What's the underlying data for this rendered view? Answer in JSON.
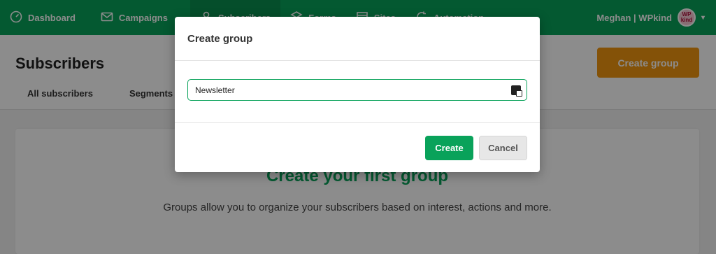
{
  "nav": {
    "items": [
      {
        "label": "Dashboard",
        "icon": "dashboard-icon"
      },
      {
        "label": "Campaigns",
        "icon": "mail-icon"
      },
      {
        "label": "Subscribers",
        "icon": "user-icon",
        "active": true
      },
      {
        "label": "Forms",
        "icon": "forms-icon"
      },
      {
        "label": "Sites",
        "icon": "sites-icon"
      },
      {
        "label": "Automation",
        "icon": "automation-icon"
      }
    ],
    "account": "Meghan | WPkind",
    "avatar_text": "WP kind"
  },
  "header": {
    "title": "Subscribers",
    "tabs": [
      "All subscribers",
      "Segments"
    ],
    "create_group_label": "Create group"
  },
  "empty_state": {
    "title": "Create your first group",
    "description": "Groups allow you to organize your subscribers based on interest, actions and more."
  },
  "modal": {
    "title": "Create group",
    "input_value": "Newsletter",
    "create_label": "Create",
    "cancel_label": "Cancel"
  },
  "colors": {
    "brand_green": "#09a25a",
    "accent_orange": "#f0950f"
  }
}
